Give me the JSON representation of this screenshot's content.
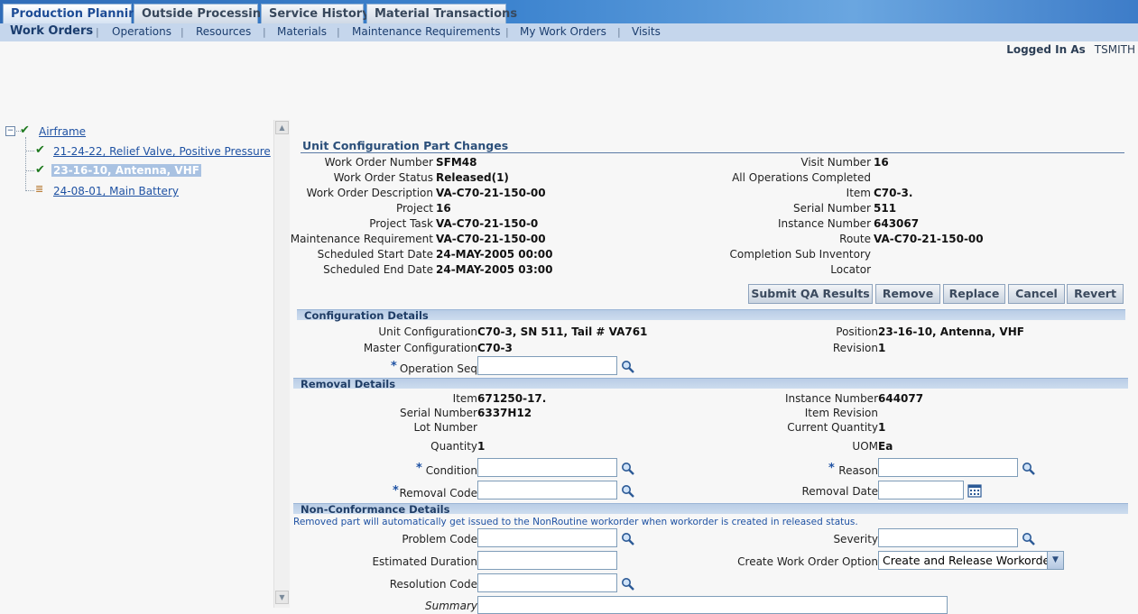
{
  "tabs": [
    "Production Planning",
    "Outside Processing",
    "Service History",
    "Material Transactions"
  ],
  "subnav": [
    "Work Orders",
    "Operations",
    "Resources",
    "Materials",
    "Maintenance Requirements",
    "My Work Orders",
    "Visits"
  ],
  "login": {
    "label": "Logged In As",
    "user": "TSMITH"
  },
  "tree": {
    "root": "Airframe",
    "items": [
      "21-24-22, Relief Valve, Positive Pressure",
      "23-16-10, Antenna, VHF",
      "24-08-01, Main Battery"
    ]
  },
  "header": {
    "title": "Unit Configuration Part Changes",
    "left": [
      {
        "label": "Work Order Number",
        "value": "SFM48"
      },
      {
        "label": "Work Order Status",
        "value": "Released(1)"
      },
      {
        "label": "Work Order Description",
        "value": "VA-C70-21-150-00"
      },
      {
        "label": "Project",
        "value": "16"
      },
      {
        "label": "Project Task",
        "value": "VA-C70-21-150-0"
      },
      {
        "label": "Maintenance Requirement",
        "value": "VA-C70-21-150-00"
      },
      {
        "label": "Scheduled Start Date",
        "value": "24-MAY-2005 00:00"
      },
      {
        "label": "Scheduled End Date",
        "value": "24-MAY-2005 03:00"
      }
    ],
    "right": [
      {
        "label": "Visit Number",
        "value": "16"
      },
      {
        "label": "All Operations Completed",
        "value": ""
      },
      {
        "label": "Item",
        "value": "C70-3."
      },
      {
        "label": "Serial Number",
        "value": "511"
      },
      {
        "label": "Instance Number",
        "value": "643067"
      },
      {
        "label": "Route",
        "value": "VA-C70-21-150-00"
      },
      {
        "label": "Completion Sub Inventory",
        "value": ""
      },
      {
        "label": "Locator",
        "value": ""
      }
    ]
  },
  "buttons": [
    "Submit QA Results",
    "Remove",
    "Replace",
    "Cancel",
    "Revert"
  ],
  "config": {
    "title": "Configuration Details",
    "unit_label": "Unit Configuration",
    "unit_value": "C70-3, SN 511, Tail # VA761",
    "master_label": "Master Configuration",
    "master_value": "C70-3",
    "position_label": "Position",
    "position_value": "23-16-10, Antenna, VHF",
    "revision_label": "Revision",
    "revision_value": "1",
    "opseq_label": "Operation Seq"
  },
  "removal": {
    "title": "Removal Details",
    "item_label": "Item",
    "item_value": "671250-17.",
    "serial_label": "Serial Number",
    "serial_value": "6337H12",
    "lot_label": "Lot Number",
    "qty_label": "Quantity",
    "qty_value": "1",
    "instance_label": "Instance Number",
    "instance_value": "644077",
    "itemrev_label": "Item Revision",
    "curqty_label": "Current Quantity",
    "curqty_value": "1",
    "uom_label": "UOM",
    "uom_value": "Ea",
    "condition_label": "Condition",
    "reason_label": "Reason",
    "removal_code_label": "Removal Code",
    "removal_date_label": "Removal Date"
  },
  "nonconf": {
    "title": "Non-Conformance Details",
    "note": "Removed part will automatically get issued to the NonRoutine workorder when workorder is created in released status.",
    "problem_label": "Problem Code",
    "est_label": "Estimated Duration",
    "resolution_label": "Resolution Code",
    "summary_label": "Summary",
    "severity_label": "Severity",
    "cwo_label": "Create Work Order Option",
    "cwo_value": "Create and Release Workorder"
  },
  "colors": {
    "accent": "#1f52a3",
    "tabbar": "#3d84cf",
    "subbar": "#c5d6ec",
    "section": "#c4d6ec"
  }
}
